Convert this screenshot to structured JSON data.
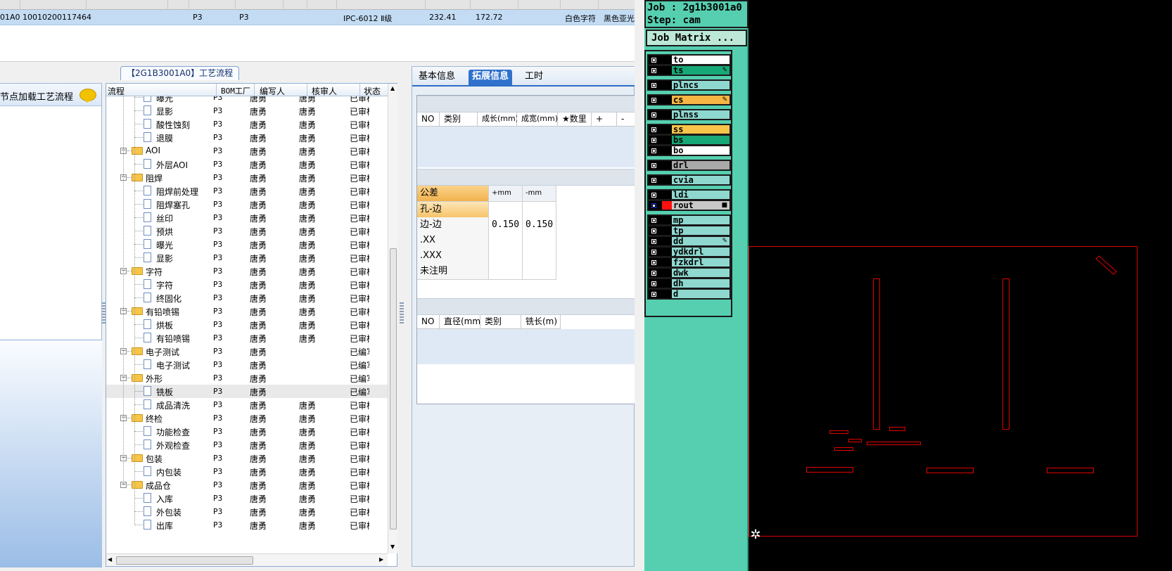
{
  "top_row": {
    "data_cells": [
      "01A0",
      "10010200117464",
      "P3",
      "P3",
      "IPC-6012 Ⅱ级",
      "232.41",
      "172.72",
      "白色字符",
      "黑色亚光"
    ]
  },
  "left_panel": {
    "header": "节点加载工艺流程"
  },
  "flow_tree": {
    "title": "【2G1B3001A0】工艺流程",
    "columns": [
      "流程",
      "BOM工厂",
      "编写人",
      "核审人",
      "状态"
    ],
    "rows": [
      {
        "level": 2,
        "kind": "item",
        "name": "曝光",
        "bom": "P3",
        "writer": "唐勇",
        "reviewer": "唐勇",
        "status": "已审核"
      },
      {
        "level": 2,
        "kind": "item",
        "name": "显影",
        "bom": "P3",
        "writer": "唐勇",
        "reviewer": "唐勇",
        "status": "已审核"
      },
      {
        "level": 2,
        "kind": "item",
        "name": "酸性蚀刻",
        "bom": "P3",
        "writer": "唐勇",
        "reviewer": "唐勇",
        "status": "已审核"
      },
      {
        "level": 2,
        "kind": "item",
        "name": "退膜",
        "bom": "P3",
        "writer": "唐勇",
        "reviewer": "唐勇",
        "status": "已审核"
      },
      {
        "level": 1,
        "kind": "folder",
        "name": "AOI",
        "bom": "P3",
        "writer": "唐勇",
        "reviewer": "唐勇",
        "status": "已审核"
      },
      {
        "level": 2,
        "kind": "item",
        "name": "外层AOI",
        "bom": "P3",
        "writer": "唐勇",
        "reviewer": "唐勇",
        "status": "已审核"
      },
      {
        "level": 1,
        "kind": "folder",
        "name": "阻焊",
        "bom": "P3",
        "writer": "唐勇",
        "reviewer": "唐勇",
        "status": "已审核"
      },
      {
        "level": 2,
        "kind": "item",
        "name": "阻焊前处理",
        "bom": "P3",
        "writer": "唐勇",
        "reviewer": "唐勇",
        "status": "已审核"
      },
      {
        "level": 2,
        "kind": "item",
        "name": "阻焊塞孔",
        "bom": "P3",
        "writer": "唐勇",
        "reviewer": "唐勇",
        "status": "已审核"
      },
      {
        "level": 2,
        "kind": "item",
        "name": "丝印",
        "bom": "P3",
        "writer": "唐勇",
        "reviewer": "唐勇",
        "status": "已审核"
      },
      {
        "level": 2,
        "kind": "item",
        "name": "预烘",
        "bom": "P3",
        "writer": "唐勇",
        "reviewer": "唐勇",
        "status": "已审核"
      },
      {
        "level": 2,
        "kind": "item",
        "name": "曝光",
        "bom": "P3",
        "writer": "唐勇",
        "reviewer": "唐勇",
        "status": "已审核"
      },
      {
        "level": 2,
        "kind": "item",
        "name": "显影",
        "bom": "P3",
        "writer": "唐勇",
        "reviewer": "唐勇",
        "status": "已审核"
      },
      {
        "level": 1,
        "kind": "folder",
        "name": "字符",
        "bom": "P3",
        "writer": "唐勇",
        "reviewer": "唐勇",
        "status": "已审核"
      },
      {
        "level": 2,
        "kind": "item",
        "name": "字符",
        "bom": "P3",
        "writer": "唐勇",
        "reviewer": "唐勇",
        "status": "已审核"
      },
      {
        "level": 2,
        "kind": "item",
        "name": "终固化",
        "bom": "P3",
        "writer": "唐勇",
        "reviewer": "唐勇",
        "status": "已审核"
      },
      {
        "level": 1,
        "kind": "folder",
        "name": "有铅喷锡",
        "bom": "P3",
        "writer": "唐勇",
        "reviewer": "唐勇",
        "status": "已审核"
      },
      {
        "level": 2,
        "kind": "item",
        "name": "烘板",
        "bom": "P3",
        "writer": "唐勇",
        "reviewer": "唐勇",
        "status": "已审核"
      },
      {
        "level": 2,
        "kind": "item",
        "name": "有铅喷锡",
        "bom": "P3",
        "writer": "唐勇",
        "reviewer": "唐勇",
        "status": "已审核"
      },
      {
        "level": 1,
        "kind": "folder",
        "name": "电子测试",
        "bom": "P3",
        "writer": "唐勇",
        "reviewer": "",
        "status": "已编写"
      },
      {
        "level": 2,
        "kind": "item",
        "name": "电子测试",
        "bom": "P3",
        "writer": "唐勇",
        "reviewer": "",
        "status": "已编写"
      },
      {
        "level": 1,
        "kind": "folder",
        "name": "外形",
        "bom": "P3",
        "writer": "唐勇",
        "reviewer": "",
        "status": "已编写"
      },
      {
        "level": 2,
        "kind": "item",
        "name": "铣板",
        "bom": "P3",
        "writer": "唐勇",
        "reviewer": "",
        "status": "已编写",
        "selected": true
      },
      {
        "level": 2,
        "kind": "item",
        "name": "成品清洗",
        "bom": "P3",
        "writer": "唐勇",
        "reviewer": "唐勇",
        "status": "已审核"
      },
      {
        "level": 1,
        "kind": "folder",
        "name": "终检",
        "bom": "P3",
        "writer": "唐勇",
        "reviewer": "唐勇",
        "status": "已审核"
      },
      {
        "level": 2,
        "kind": "item",
        "name": "功能检查",
        "bom": "P3",
        "writer": "唐勇",
        "reviewer": "唐勇",
        "status": "已审核"
      },
      {
        "level": 2,
        "kind": "item",
        "name": "外观检查",
        "bom": "P3",
        "writer": "唐勇",
        "reviewer": "唐勇",
        "status": "已审核"
      },
      {
        "level": 1,
        "kind": "folder",
        "name": "包装",
        "bom": "P3",
        "writer": "唐勇",
        "reviewer": "唐勇",
        "status": "已审核"
      },
      {
        "level": 2,
        "kind": "item",
        "name": "内包装",
        "bom": "P3",
        "writer": "唐勇",
        "reviewer": "唐勇",
        "status": "已审核"
      },
      {
        "level": 1,
        "kind": "folder",
        "name": "成品仓",
        "bom": "P3",
        "writer": "唐勇",
        "reviewer": "唐勇",
        "status": "已审核"
      },
      {
        "level": 2,
        "kind": "item",
        "name": "入库",
        "bom": "P3",
        "writer": "唐勇",
        "reviewer": "唐勇",
        "status": "已审核"
      },
      {
        "level": 2,
        "kind": "item",
        "name": "外包装",
        "bom": "P3",
        "writer": "唐勇",
        "reviewer": "唐勇",
        "status": "已审核"
      },
      {
        "level": 2,
        "kind": "item",
        "name": "出库",
        "bom": "P3",
        "writer": "唐勇",
        "reviewer": "唐勇",
        "status": "已审核"
      }
    ]
  },
  "detail_panel": {
    "tabs": [
      "基本信息",
      "拓展信息",
      "工时"
    ],
    "active_tab": 1,
    "grid1_columns": [
      "NO",
      "类别",
      "成长(mm)",
      "成宽(mm)",
      "★数里",
      "+",
      "-"
    ],
    "tolerance": {
      "columns": [
        "公差",
        "+mm",
        "-mm"
      ],
      "rows": [
        {
          "label": "孔-边",
          "plus": "",
          "minus": ""
        },
        {
          "label": "边-边",
          "plus": "0.150",
          "minus": "0.150"
        },
        {
          "label": ".XX",
          "plus": "",
          "minus": ""
        },
        {
          "label": ".XXX",
          "plus": "",
          "minus": ""
        },
        {
          "label": "未注明",
          "plus": "",
          "minus": ""
        }
      ]
    },
    "grid3_columns": [
      "NO",
      "直径(mm)",
      "类别",
      "铣长(m)"
    ]
  },
  "cam": {
    "job": "Job : 2g1b3001a0",
    "step": "Step: cam",
    "matrix_button": "Job Matrix ...",
    "layers": [
      {
        "name": "to",
        "color": "#ffffff"
      },
      {
        "name": "ts",
        "color": "#17a878",
        "mark": "✎"
      },
      {
        "name": "plncs",
        "color": "#8fd8d0"
      },
      {
        "name": "cs",
        "color": "#f7b543",
        "mark": "✎"
      },
      {
        "name": "plnss",
        "color": "#8fd8d0"
      },
      {
        "name": "ss",
        "color": "#f7c54a"
      },
      {
        "name": "bs",
        "color": "#17a878"
      },
      {
        "name": "bo",
        "color": "#ffffff"
      },
      {
        "name": "drl",
        "color": "#a9a9a9"
      },
      {
        "name": "cvia",
        "color": "#8fd8d0"
      },
      {
        "name": "ldi",
        "color": "#8fd8d0"
      },
      {
        "name": "rout",
        "color": "#c8c8c8",
        "active": true,
        "mark": "■"
      },
      {
        "name": "mp",
        "color": "#8fd8d0"
      },
      {
        "name": "tp",
        "color": "#8fd8d0"
      },
      {
        "name": "dd",
        "color": "#8fd8d0",
        "mark": "✎"
      },
      {
        "name": "ydkdrl",
        "color": "#8fd8d0"
      },
      {
        "name": "fzkdrl",
        "color": "#8fd8d0"
      },
      {
        "name": "dwk",
        "color": "#8fd8d0"
      },
      {
        "name": "dh",
        "color": "#8fd8d0"
      },
      {
        "name": "d",
        "color": "#8fd8d0"
      }
    ],
    "outline_color": "#e00000"
  }
}
